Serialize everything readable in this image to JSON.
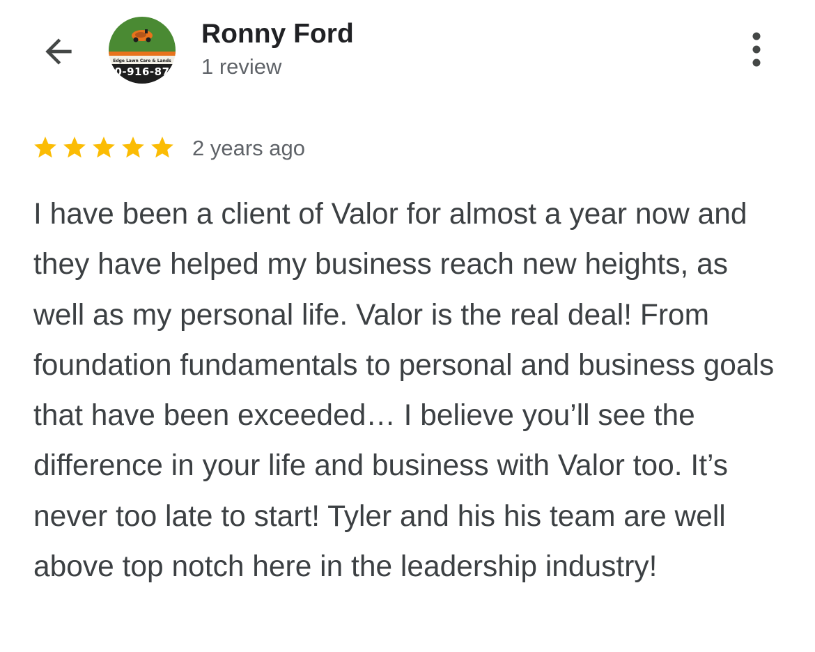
{
  "header": {
    "back_icon": "arrow-back-icon",
    "avatar": {
      "banner_text": "Edge Lawn Care & Lands",
      "phone_text": "0-916-87",
      "colors": {
        "green": "#4a8a33",
        "orange": "#e8731c",
        "dark": "#1e1e1e"
      }
    },
    "reviewer_name": "Ronny Ford",
    "review_count": "1 review",
    "more_icon": "more-vert-icon"
  },
  "review": {
    "rating": 5,
    "max_rating": 5,
    "star_color": "#fbbc04",
    "timestamp": "2 years ago",
    "text": "I have been a client of Valor for almost a year now and they have helped my business reach new heights, as well as my personal life. Valor is the real deal! From foundation fundamentals to personal and business goals that have been exceeded… I believe you’ll see the difference in your life and business with Valor too. It’s never too late to start! Tyler and his his team are well above top notch here in the leadership industry!"
  }
}
